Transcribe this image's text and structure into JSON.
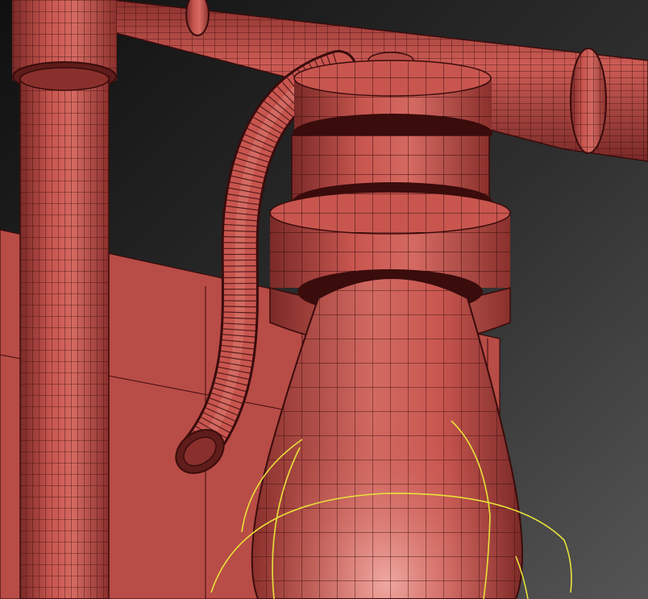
{
  "scene": {
    "type": "3d-viewport-wireframe-render",
    "background_colors": [
      "#141414",
      "#4a4a4a"
    ],
    "mesh_color": "#c8564f",
    "wire_color": "#3a0c0c",
    "selection_gizmo_color": "#e8e23a",
    "objects": [
      "top-horizontal-pipe",
      "left-vertical-pipe",
      "pipe-elbow-joint",
      "back-wall-panel",
      "curved-hose",
      "hose-end-ring",
      "tank-cap-top",
      "tank-collar-upper",
      "tank-collar-lower",
      "tank-body",
      "selection-gizmo"
    ]
  }
}
